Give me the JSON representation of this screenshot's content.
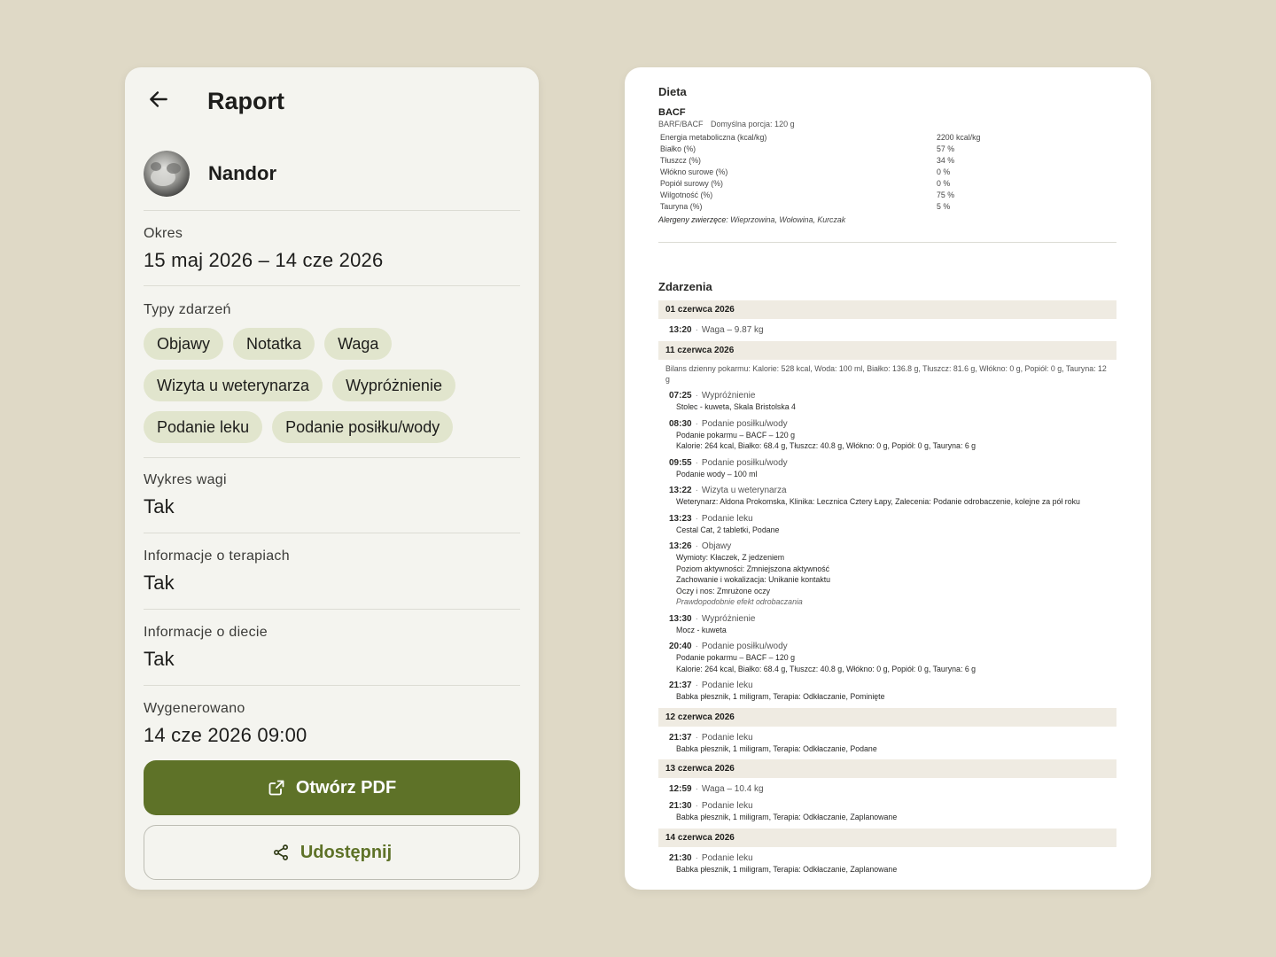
{
  "report": {
    "title": "Raport",
    "pet_name": "Nandor",
    "period_label": "Okres",
    "period_value": "15 maj 2026 – 14 cze 2026",
    "event_types_label": "Typy zdarzeń",
    "event_types": [
      "Objawy",
      "Notatka",
      "Waga",
      "Wizyta u weterynarza",
      "Wypróżnienie",
      "Podanie leku",
      "Podanie posiłku/wody"
    ],
    "weight_chart_label": "Wykres wagi",
    "weight_chart_value": "Tak",
    "therapy_label": "Informacje o terapiach",
    "therapy_value": "Tak",
    "diet_label": "Informacje o diecie",
    "diet_value": "Tak",
    "generated_label": "Wygenerowano",
    "generated_value": "14 cze 2026 09:00",
    "open_pdf_label": "Otwórz PDF",
    "share_label": "Udostępnij"
  },
  "pdf": {
    "diet_title": "Dieta",
    "diet_name": "BACF",
    "diet_type": "BARF/BACF",
    "diet_portion": "Domyślna porcja: 120 g",
    "nutrients": [
      {
        "name": "Energia metaboliczna (kcal/kg)",
        "value": "2200 kcal/kg"
      },
      {
        "name": "Białko (%)",
        "value": "57 %"
      },
      {
        "name": "Tłuszcz (%)",
        "value": "34 %"
      },
      {
        "name": "Włókno surowe (%)",
        "value": "0 %"
      },
      {
        "name": "Popiół surowy (%)",
        "value": "0 %"
      },
      {
        "name": "Wilgotność (%)",
        "value": "75 %"
      },
      {
        "name": "Tauryna (%)",
        "value": "5 %"
      }
    ],
    "allergens_label": "Alergeny zwierzęce:",
    "allergens_value": "Wieprzowina, Wołowina, Kurczak",
    "events_title": "Zdarzenia",
    "days": [
      {
        "date": "01 czerwca 2026",
        "events": [
          {
            "time": "13:20",
            "kind": "Waga – 9.87 kg",
            "lines": []
          }
        ]
      },
      {
        "date": "11 czerwca 2026",
        "summary": "Bilans dzienny pokarmu: Kalorie: 528 kcal, Woda: 100 ml, Białko: 136.8 g, Tłuszcz: 81.6 g, Włókno: 0 g, Popiół: 0 g, Tauryna: 12 g",
        "events": [
          {
            "time": "07:25",
            "kind": "Wypróżnienie",
            "lines": [
              "Stolec - kuweta, Skala Bristolska 4"
            ]
          },
          {
            "time": "08:30",
            "kind": "Podanie posiłku/wody",
            "lines": [
              "Podanie pokarmu – BACF – 120 g",
              "Kalorie: 264 kcal, Białko: 68.4 g, Tłuszcz: 40.8 g, Włókno: 0 g, Popiół: 0 g, Tauryna: 6 g"
            ]
          },
          {
            "time": "09:55",
            "kind": "Podanie posiłku/wody",
            "lines": [
              "Podanie wody – 100 ml"
            ]
          },
          {
            "time": "13:22",
            "kind": "Wizyta u weterynarza",
            "lines": [
              "Weterynarz: Aldona Prokomska, Klinika: Lecznica Cztery Łapy, Zalecenia: Podanie odrobaczenie, kolejne za pół roku"
            ]
          },
          {
            "time": "13:23",
            "kind": "Podanie leku",
            "lines": [
              "Cestal Cat, 2 tabletki, Podane"
            ]
          },
          {
            "time": "13:26",
            "kind": "Objawy",
            "lines": [
              "Wymioty: Kłaczek, Z jedzeniem",
              "Poziom aktywności: Zmniejszona aktywność",
              "Zachowanie i wokalizacja: Unikanie kontaktu",
              "Oczy i nos: Zmrużone oczy"
            ],
            "note": "Prawdopodobnie efekt odrobaczania"
          },
          {
            "time": "13:30",
            "kind": "Wypróżnienie",
            "lines": [
              "Mocz - kuweta"
            ]
          },
          {
            "time": "20:40",
            "kind": "Podanie posiłku/wody",
            "lines": [
              "Podanie pokarmu – BACF – 120 g",
              "Kalorie: 264 kcal, Białko: 68.4 g, Tłuszcz: 40.8 g, Włókno: 0 g, Popiół: 0 g, Tauryna: 6 g"
            ]
          },
          {
            "time": "21:37",
            "kind": "Podanie leku",
            "lines": [
              "Babka płesznik, 1 miligram, Terapia: Odkłaczanie, Pominięte"
            ]
          }
        ]
      },
      {
        "date": "12 czerwca 2026",
        "events": [
          {
            "time": "21:37",
            "kind": "Podanie leku",
            "lines": [
              "Babka płesznik, 1 miligram, Terapia: Odkłaczanie, Podane"
            ]
          }
        ]
      },
      {
        "date": "13 czerwca 2026",
        "events": [
          {
            "time": "12:59",
            "kind": "Waga – 10.4 kg",
            "lines": []
          },
          {
            "time": "21:30",
            "kind": "Podanie leku",
            "lines": [
              "Babka płesznik, 1 miligram, Terapia: Odkłaczanie, Zaplanowane"
            ]
          }
        ]
      },
      {
        "date": "14 czerwca 2026",
        "events": [
          {
            "time": "21:30",
            "kind": "Podanie leku",
            "lines": [
              "Babka płesznik, 1 miligram, Terapia: Odkłaczanie, Zaplanowane"
            ]
          }
        ]
      }
    ]
  },
  "colors": {
    "background": "#dfd9c6",
    "primary": "#5e7228",
    "chip": "#e1e5cd",
    "day_band": "#efebe2"
  },
  "icons": {
    "back": "arrow-left-icon",
    "open_pdf": "external-link-icon",
    "share": "share-icon"
  }
}
